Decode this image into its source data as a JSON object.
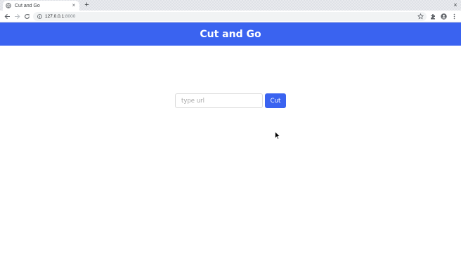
{
  "browser": {
    "tab_title": "Cut and Go",
    "new_tab_symbol": "+",
    "tab_close_symbol": "×",
    "window_close_symbol": "×",
    "url_host": "127.0.0.1",
    "url_port": ":8000"
  },
  "app": {
    "brand": "Cut and Go",
    "brand_color": "#3a63f0",
    "url_placeholder": "type url",
    "url_value": "",
    "cut_label": "Cut"
  }
}
